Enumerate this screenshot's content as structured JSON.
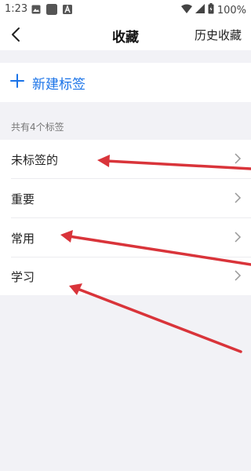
{
  "status_bar": {
    "time": "1:23",
    "battery": "100%",
    "icons_left": [
      "image-icon",
      "app-square-icon",
      "a-icon"
    ],
    "icons_right": [
      "wifi-icon",
      "cell-signal-icon",
      "battery-icon"
    ]
  },
  "nav": {
    "title": "收藏",
    "right": "历史收藏"
  },
  "new_tag": {
    "label": "新建标签",
    "color": "#1a73e8"
  },
  "section_label": "共有4个标签",
  "tags": [
    {
      "name": "未标签的"
    },
    {
      "name": "重要"
    },
    {
      "name": "常用"
    },
    {
      "name": "学习"
    }
  ],
  "annotation_color": "#d9343a"
}
